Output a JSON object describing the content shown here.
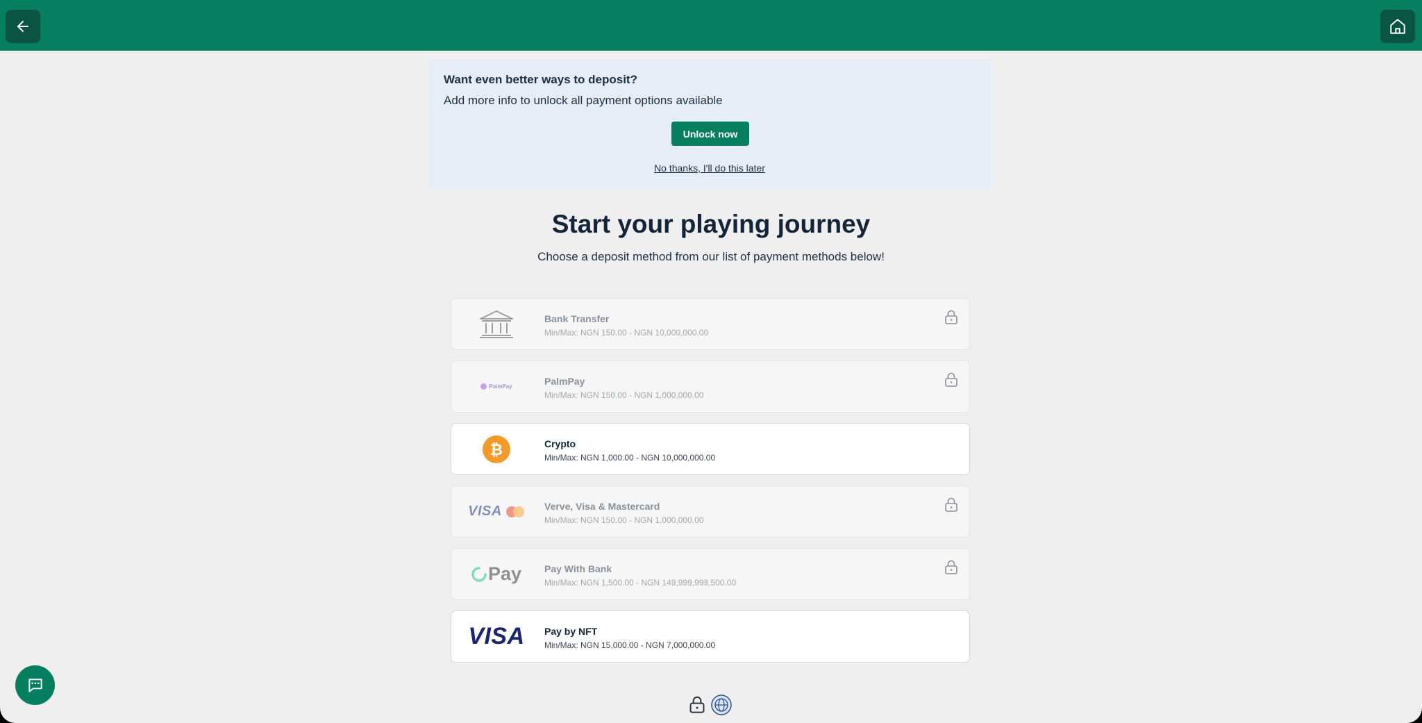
{
  "topbar": {
    "back_icon": "arrow-left-icon",
    "home_icon": "home-icon"
  },
  "promo": {
    "title": "Want even better ways to deposit?",
    "subtitle": "Add more info to unlock all payment options available",
    "unlock_label": "Unlock now",
    "later_label": "No thanks, I'll do this later"
  },
  "main": {
    "heading": "Start your playing journey",
    "subheading": "Choose a deposit method from our list of payment methods below!"
  },
  "methods": [
    {
      "name": "Bank Transfer",
      "range": "Min/Max: NGN 150.00 - NGN 10,000,000.00",
      "locked": true,
      "icon": "bank-icon"
    },
    {
      "name": "PalmPay",
      "range": "Min/Max: NGN 150.00 - NGN 1,000,000.00",
      "locked": true,
      "icon": "palmpay-logo",
      "logo_text": "PalmPay"
    },
    {
      "name": "Crypto",
      "range": "Min/Max: NGN 1,000.00 - NGN 10,000,000.00",
      "locked": false,
      "icon": "bitcoin-icon"
    },
    {
      "name": "Verve, Visa & Mastercard",
      "range": "Min/Max: NGN 150.00 - NGN 1,000,000.00",
      "locked": true,
      "icon": "visa-mastercard-logo",
      "logo_text": "VISA"
    },
    {
      "name": "Pay With Bank",
      "range": "Min/Max: NGN 1,500.00 - NGN 149,999,998,500.00",
      "locked": true,
      "icon": "opay-logo",
      "logo_text": "Pay"
    },
    {
      "name": "Pay by NFT",
      "range": "Min/Max: NGN 15,000.00 - NGN 7,000,000.00",
      "locked": false,
      "icon": "visa-logo",
      "logo_text": "VISA"
    }
  ],
  "footer": {
    "icons": [
      "lock-icon",
      "globe-badge-icon"
    ]
  },
  "chat": {
    "icon": "chat-icon"
  },
  "colors": {
    "brand_green": "#067f60",
    "dark_green": "#0a5443",
    "promo_bg": "#e7edf6",
    "page_bg": "#efefef",
    "heading": "#14253a"
  }
}
